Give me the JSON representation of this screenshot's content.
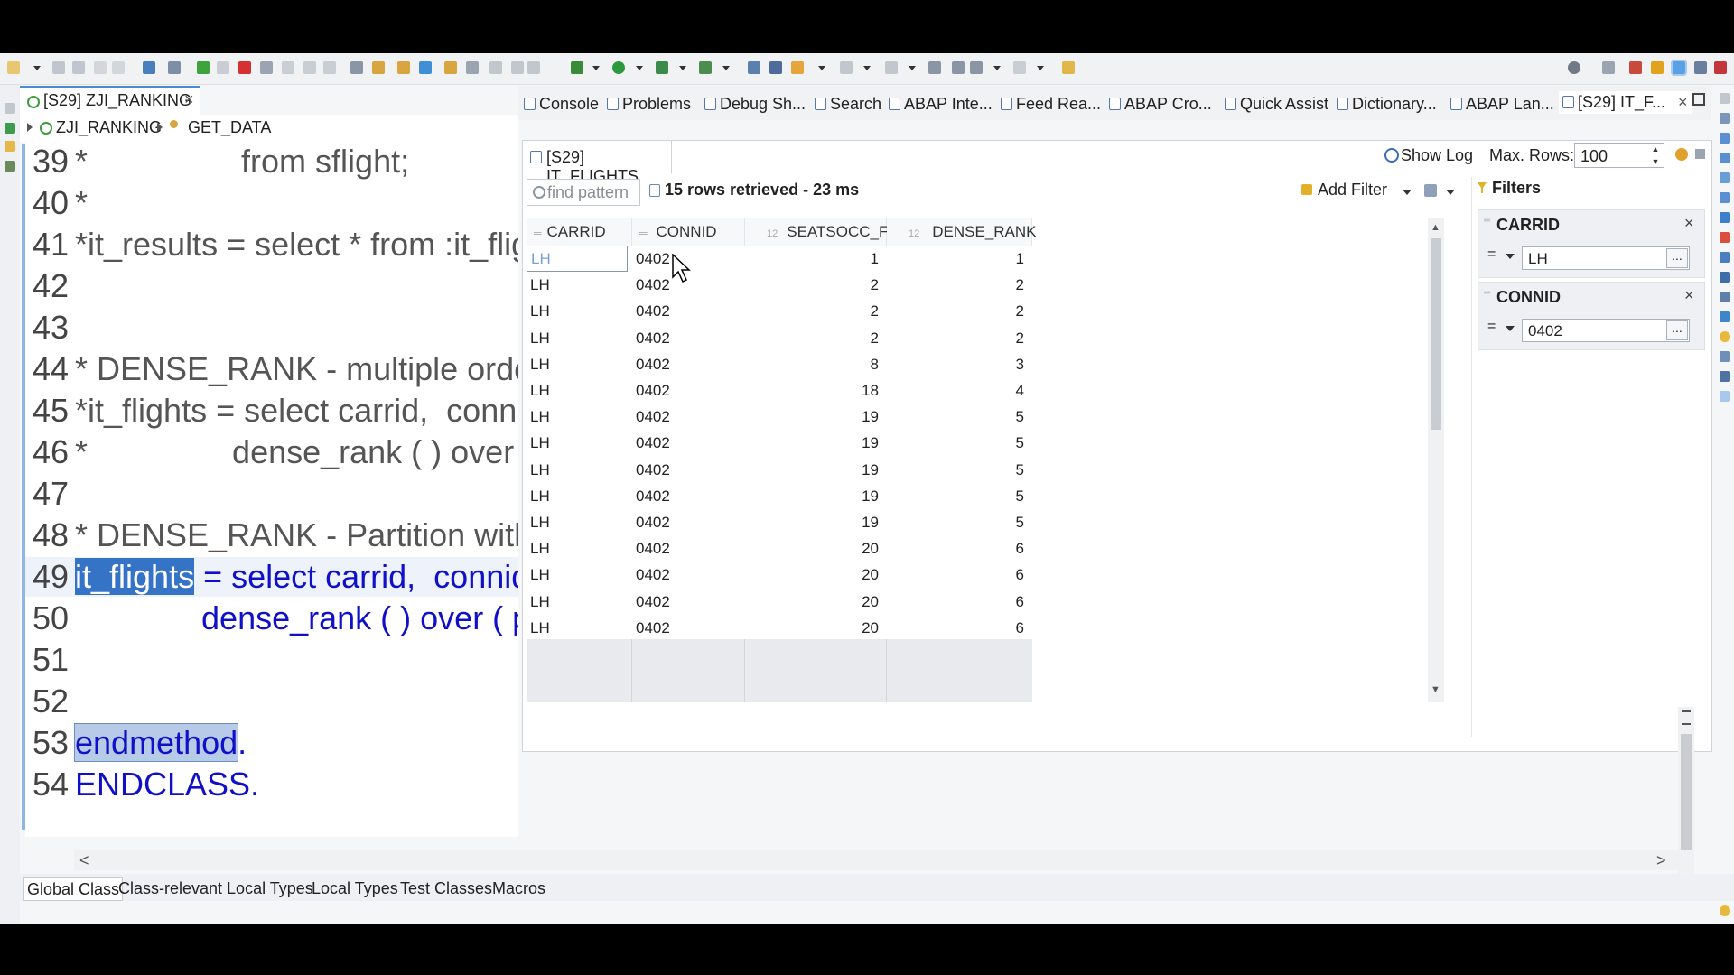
{
  "editor": {
    "tab_title": "[S29] ZJI_RANKING",
    "breadcrumb": [
      "ZJI_RANKING",
      "GET_DATA"
    ],
    "lines": [
      {
        "num": "39",
        "text": "*                 from sflight;"
      },
      {
        "num": "40",
        "text": "*"
      },
      {
        "num": "41",
        "text": "*it_results = select * from :it_flights"
      },
      {
        "num": "42",
        "text": ""
      },
      {
        "num": "43",
        "text": ""
      },
      {
        "num": "44",
        "text": "* DENSE_RANK - multiple order f"
      },
      {
        "num": "45",
        "text": "*it_flights = select carrid,  connid,"
      },
      {
        "num": "46",
        "text": "*                dense_rank ( ) over ( c"
      },
      {
        "num": "47",
        "text": ""
      },
      {
        "num": "48",
        "text": "* DENSE_RANK - Partition with s"
      },
      {
        "num": "49",
        "hl": "it_flights",
        "text": " = select carrid,  connid,  s"
      },
      {
        "num": "50",
        "text": "              dense_rank ( ) over ( pa"
      },
      {
        "num": "51",
        "text": ""
      },
      {
        "num": "52",
        "text": ""
      },
      {
        "num": "53",
        "hl": "endmethod",
        "text": "."
      },
      {
        "num": "54",
        "text": "ENDCLASS."
      }
    ]
  },
  "view_tabs": [
    "Console",
    "Problems",
    "Debug Sh...",
    "Search",
    "ABAP Inte...",
    "Feed Rea...",
    "ABAP Cro...",
    "Quick Assist",
    "Dictionary...",
    "ABAP Lan...",
    "[S29] IT_F..."
  ],
  "data_preview": {
    "tab_title": "[S29] IT_FLIGHTS",
    "show_log": "Show Log",
    "max_rows_label": "Max. Rows:",
    "max_rows_value": "100",
    "find_placeholder": "find pattern",
    "status": "15 rows retrieved - 23 ms",
    "add_filter": "Add Filter",
    "columns": [
      "CARRID",
      "CONNID",
      "SEATSOCC_F",
      "DENSE_RANK"
    ],
    "rows": [
      [
        "LH",
        "0402",
        "1",
        "1"
      ],
      [
        "LH",
        "0402",
        "2",
        "2"
      ],
      [
        "LH",
        "0402",
        "2",
        "2"
      ],
      [
        "LH",
        "0402",
        "2",
        "2"
      ],
      [
        "LH",
        "0402",
        "8",
        "3"
      ],
      [
        "LH",
        "0402",
        "18",
        "4"
      ],
      [
        "LH",
        "0402",
        "19",
        "5"
      ],
      [
        "LH",
        "0402",
        "19",
        "5"
      ],
      [
        "LH",
        "0402",
        "19",
        "5"
      ],
      [
        "LH",
        "0402",
        "19",
        "5"
      ],
      [
        "LH",
        "0402",
        "19",
        "5"
      ],
      [
        "LH",
        "0402",
        "20",
        "6"
      ],
      [
        "LH",
        "0402",
        "20",
        "6"
      ],
      [
        "LH",
        "0402",
        "20",
        "6"
      ],
      [
        "LH",
        "0402",
        "20",
        "6"
      ]
    ]
  },
  "filters": {
    "title": "Filters",
    "items": [
      {
        "field": "CARRID",
        "op": "=",
        "value": "LH",
        "btn": "..."
      },
      {
        "field": "CONNID",
        "op": "=",
        "value": "0402",
        "btn": "..."
      }
    ]
  },
  "bottom_tabs": [
    "Global Class",
    "Class-relevant Local Types",
    "Local Types",
    "Test Classes",
    "Macros"
  ],
  "symbols": {
    "close": "×",
    "scroll_left": "<",
    "scroll_right": ">",
    "scroll_up": "▲",
    "scroll_down": "▼"
  }
}
